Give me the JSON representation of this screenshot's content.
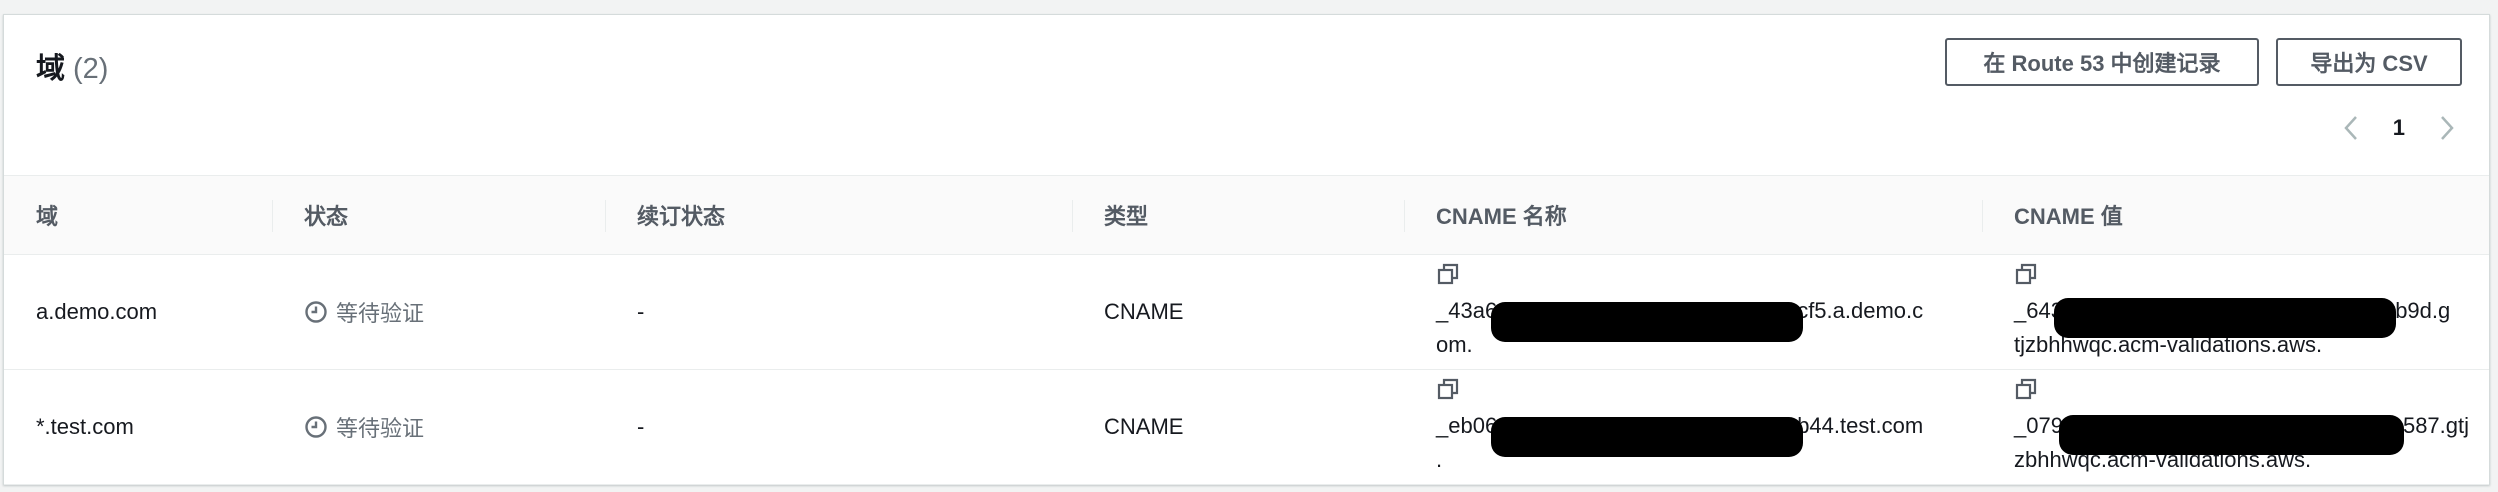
{
  "header": {
    "title": "域",
    "count": "(2)",
    "create_route53_label": "在 Route 53 中创建记录",
    "export_csv_label": "导出为 CSV"
  },
  "pagination": {
    "current_page": "1"
  },
  "table": {
    "columns": [
      "域",
      "状态",
      "续订状态",
      "类型",
      "CNAME 名称",
      "CNAME 值"
    ],
    "rows": [
      {
        "domain": "a.demo.com",
        "status": "等待验证",
        "renewal_status": "-",
        "type": "CNAME",
        "cname_name_prefix": "_43a6",
        "cname_name_suffix": "cf5.a.demo.c",
        "cname_name_line2": "om.",
        "cname_value_prefix": "_643",
        "cname_value_suffix": "2b9d.g",
        "cname_value_line2": "tjzbhhwqc.acm-validations.aws."
      },
      {
        "domain": "*.test.com",
        "status": "等待验证",
        "renewal_status": "-",
        "type": "CNAME",
        "cname_name_prefix": "_eb06",
        "cname_name_suffix": "b44.test.com",
        "cname_name_line2": ".",
        "cname_value_prefix": "_079",
        "cname_value_suffix": "587.gtj",
        "cname_value_line2": "zbhhwqc.acm-validations.aws."
      }
    ]
  },
  "icons": {
    "status_icon": "clock-icon",
    "copy_icon": "copy-icon",
    "prev_icon": "chevron-left-icon",
    "next_icon": "chevron-right-icon"
  }
}
